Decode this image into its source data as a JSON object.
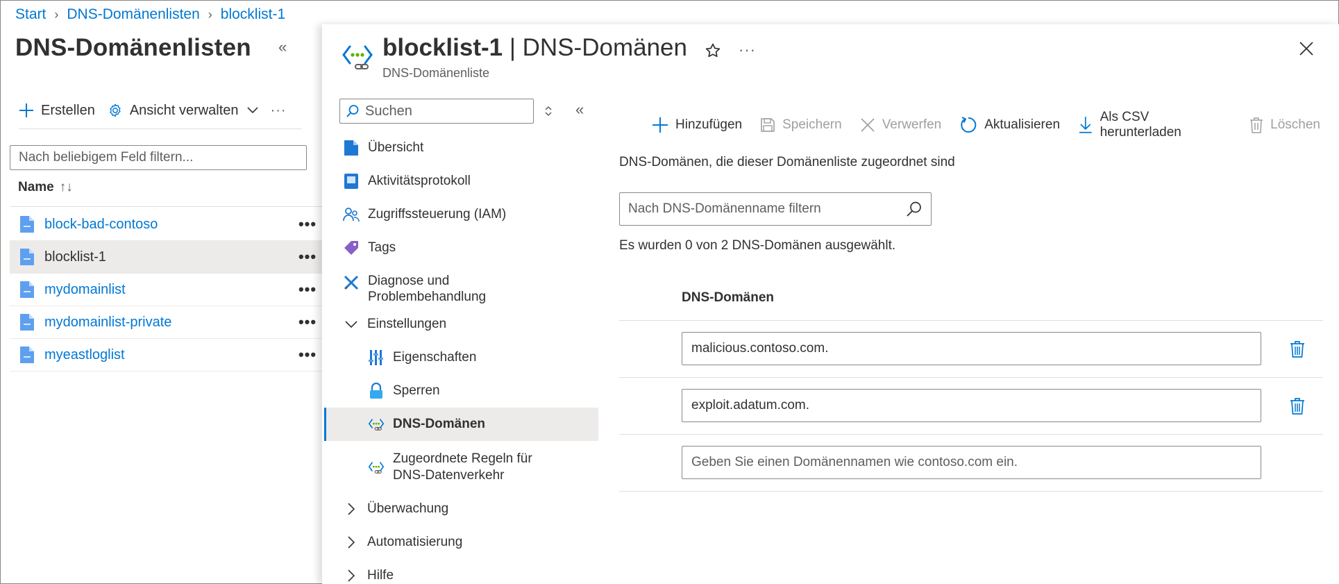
{
  "breadcrumb": {
    "items": [
      "Start",
      "DNS-Domänenlisten",
      "blocklist-1"
    ]
  },
  "left_blade": {
    "title": "DNS-Domänenlisten",
    "toolbar": {
      "create_label": "Erstellen",
      "manage_view_label": "Ansicht verwalten",
      "more": "···"
    },
    "filter_placeholder": "Nach beliebigem Feld filtern...",
    "column_name": "Name",
    "sort_indicator": "↑↓",
    "items": [
      {
        "name": "block-bad-contoso",
        "selected": false
      },
      {
        "name": "blocklist-1",
        "selected": true
      },
      {
        "name": "mydomainlist",
        "selected": false
      },
      {
        "name": "mydomainlist-private",
        "selected": false
      },
      {
        "name": "myeastloglist",
        "selected": false
      }
    ],
    "row_more": "•••"
  },
  "main_blade": {
    "title_resource": "blocklist-1",
    "title_separator": " | ",
    "title_page": "DNS-Domänen",
    "subtitle": "DNS-Domänenliste",
    "more": "···"
  },
  "menu": {
    "search_placeholder": "Suchen",
    "items": {
      "overview": "Übersicht",
      "activity_log": "Aktivitätsprotokoll",
      "iam": "Zugriffssteuerung (IAM)",
      "tags": "Tags",
      "diagnose_line1": "Diagnose und",
      "diagnose_line2": "Problembehandlung",
      "settings": "Einstellungen",
      "properties": "Eigenschaften",
      "locks": "Sperren",
      "dns_domains": "DNS-Domänen",
      "rules_line1": "Zugeordnete Regeln für",
      "rules_line2": "DNS-Datenverkehr",
      "monitoring": "Überwachung",
      "automation": "Automatisierung",
      "help": "Hilfe"
    }
  },
  "commands": {
    "add": "Hinzufügen",
    "save": "Speichern",
    "discard": "Verwerfen",
    "refresh": "Aktualisieren",
    "download_csv": "Als CSV herunterladen",
    "delete": "Löschen"
  },
  "content": {
    "description": "DNS-Domänen, die dieser Domänenliste zugeordnet sind",
    "filter_placeholder": "Nach DNS-Domänenname filtern",
    "selected_info": "Es wurden 0 von 2 DNS-Domänen ausgewählt.",
    "column_header": "DNS-Domänen",
    "domains": [
      "malicious.contoso.com.",
      "exploit.adatum.com."
    ],
    "new_domain_placeholder": "Geben Sie einen Domänennamen wie contoso.com ein."
  },
  "colors": {
    "accent": "#0078d4",
    "text": "#323130",
    "muted": "#605e5c",
    "disabled": "#a19f9d",
    "selected_bg": "#edebe9"
  }
}
